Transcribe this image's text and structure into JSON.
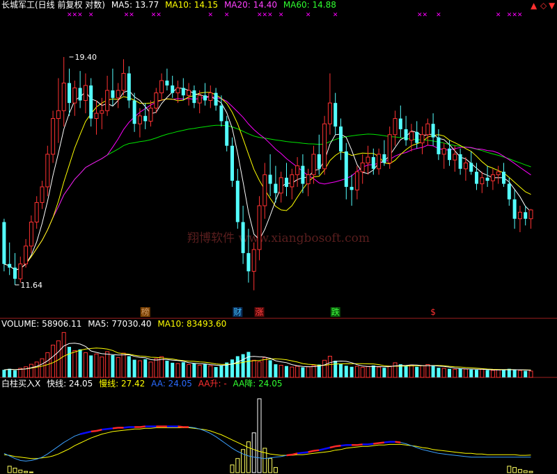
{
  "header": {
    "title": "长城军工(日线 前复权 对数)",
    "ma5": "MA5: 13.77",
    "ma10": "MA10: 14.15",
    "ma20": "MA20: 14.40",
    "ma60": "MA60: 14.88",
    "corner_up": "▲",
    "corner_diamond": "◇",
    "corner_down": "▼"
  },
  "volume_header": {
    "label": "VOLUME: 58906.11",
    "ma5": "MA5: 77030.40",
    "ma10": "MA10: 83493.60"
  },
  "indicator_header": {
    "label": "白柱买入X",
    "fast": "快线: 24.05",
    "slow": "慢线: 27.42",
    "aa": "AA: 24.05",
    "aa_up": "AA升: -",
    "aa_down": "AA降: 24.05"
  },
  "watermark": "翔博软件  www.xiangbosoft.com",
  "colors": {
    "up": "#ff3232",
    "down": "#54ffff",
    "ma5": "#ffffff",
    "ma10": "#ffff00",
    "ma20": "#ff00ff",
    "ma60": "#00e600",
    "fast": "#3ca0ff",
    "slow": "#ffff00",
    "aa": "#0a0aff",
    "aa_up": "#ff2828",
    "mark": "#ff00ff",
    "watermark": "#5a1e1e"
  },
  "chart_data": {
    "type": "candlestick",
    "price": {
      "scale": "log",
      "ylim": [
        10.8,
        21.5
      ]
    },
    "annotations": [
      {
        "text": "19.40",
        "index": 12,
        "value": 19.4
      },
      {
        "text": "11.64",
        "index": 2,
        "value": 11.64
      }
    ],
    "event_labels": [
      {
        "text": "榜",
        "index": 26,
        "color": "#cc9966",
        "bg": "#7a4000"
      },
      {
        "text": "财",
        "index": 43,
        "color": "#40c0ff",
        "bg": "#0a2e5a"
      },
      {
        "text": "涨",
        "index": 47,
        "color": "#ff4040",
        "bg": "#5a0a0a"
      },
      {
        "text": "跌",
        "index": 61,
        "color": "#40ff40",
        "bg": "#0a5a0a"
      },
      {
        "text": "$",
        "index": 79,
        "color": "#ff3030",
        "bg": ""
      }
    ],
    "marks": [
      {
        "text": "✕✕✕",
        "index": 13
      },
      {
        "text": "✕",
        "index": 16
      },
      {
        "text": "✕✕",
        "index": 23
      },
      {
        "text": "✕✕",
        "index": 28
      },
      {
        "text": "✕",
        "index": 38
      },
      {
        "text": "✕",
        "index": 41
      },
      {
        "text": "✕✕✕",
        "index": 48
      },
      {
        "text": "✕",
        "index": 51
      },
      {
        "text": "✕",
        "index": 56
      },
      {
        "text": "✕",
        "index": 61
      },
      {
        "text": "✕✕",
        "index": 77
      },
      {
        "text": "✕",
        "index": 80
      },
      {
        "text": "✕",
        "index": 91
      },
      {
        "text": "✕✕✕",
        "index": 94
      }
    ],
    "ohlc": [
      [
        13.4,
        13.5,
        12.0,
        12.2
      ],
      [
        12.2,
        12.8,
        11.9,
        12.1
      ],
      [
        12.1,
        12.5,
        11.64,
        11.8
      ],
      [
        11.8,
        12.4,
        11.7,
        12.2
      ],
      [
        12.2,
        12.9,
        12.1,
        12.7
      ],
      [
        12.7,
        13.6,
        12.5,
        13.4
      ],
      [
        13.4,
        14.2,
        13.2,
        14.0
      ],
      [
        14.0,
        14.7,
        13.8,
        14.5
      ],
      [
        14.5,
        15.9,
        14.2,
        15.6
      ],
      [
        15.6,
        17.2,
        15.3,
        16.9
      ],
      [
        16.9,
        18.5,
        16.0,
        17.2
      ],
      [
        17.2,
        19.4,
        16.6,
        18.3
      ],
      [
        18.3,
        18.9,
        17.0,
        17.5
      ],
      [
        17.5,
        18.4,
        17.0,
        18.1
      ],
      [
        18.1,
        18.8,
        17.3,
        17.6
      ],
      [
        17.6,
        18.7,
        17.1,
        18.2
      ],
      [
        18.2,
        18.5,
        16.6,
        16.9
      ],
      [
        16.9,
        17.6,
        16.3,
        17.1
      ],
      [
        17.1,
        17.7,
        16.5,
        17.2
      ],
      [
        17.2,
        18.6,
        17.0,
        18.0
      ],
      [
        18.0,
        18.9,
        17.4,
        17.7
      ],
      [
        17.7,
        18.3,
        17.3,
        18.0
      ],
      [
        18.0,
        19.3,
        17.8,
        18.7
      ],
      [
        18.7,
        19.0,
        17.3,
        17.6
      ],
      [
        17.6,
        17.9,
        16.4,
        16.7
      ],
      [
        16.7,
        17.3,
        16.2,
        17.0
      ],
      [
        17.0,
        17.5,
        16.5,
        16.8
      ],
      [
        16.8,
        17.6,
        16.6,
        17.3
      ],
      [
        17.3,
        18.1,
        17.1,
        17.9
      ],
      [
        17.9,
        18.7,
        17.6,
        18.4
      ],
      [
        18.4,
        18.9,
        18.0,
        18.2
      ],
      [
        18.2,
        18.6,
        17.7,
        17.9
      ],
      [
        17.9,
        18.4,
        17.5,
        18.1
      ],
      [
        18.1,
        18.5,
        17.6,
        17.8
      ],
      [
        17.8,
        18.3,
        17.4,
        18.0
      ],
      [
        18.0,
        18.2,
        17.3,
        17.5
      ],
      [
        17.5,
        18.0,
        17.1,
        17.8
      ],
      [
        17.8,
        18.3,
        17.4,
        17.6
      ],
      [
        17.6,
        18.2,
        17.3,
        17.9
      ],
      [
        17.9,
        18.1,
        17.2,
        17.4
      ],
      [
        17.4,
        17.8,
        16.6,
        16.8
      ],
      [
        16.8,
        17.0,
        15.7,
        15.9
      ],
      [
        15.9,
        16.2,
        14.5,
        14.7
      ],
      [
        14.7,
        15.1,
        13.2,
        13.4
      ],
      [
        13.4,
        13.9,
        12.2,
        12.5
      ],
      [
        12.5,
        13.2,
        11.7,
        12.0
      ],
      [
        12.0,
        12.8,
        11.5,
        12.6
      ],
      [
        12.6,
        14.2,
        12.3,
        13.9
      ],
      [
        13.9,
        15.3,
        13.5,
        14.9
      ],
      [
        14.9,
        15.6,
        14.2,
        14.6
      ],
      [
        14.6,
        15.2,
        14.0,
        14.3
      ],
      [
        14.3,
        15.0,
        14.0,
        14.8
      ],
      [
        14.8,
        15.3,
        14.2,
        14.5
      ],
      [
        14.5,
        15.1,
        14.1,
        14.9
      ],
      [
        14.9,
        15.5,
        14.5,
        15.2
      ],
      [
        15.2,
        15.6,
        14.3,
        14.6
      ],
      [
        14.6,
        15.1,
        14.2,
        14.9
      ],
      [
        14.9,
        15.9,
        14.6,
        15.6
      ],
      [
        15.6,
        16.3,
        14.9,
        15.1
      ],
      [
        15.1,
        17.0,
        14.9,
        16.7
      ],
      [
        16.7,
        18.7,
        16.3,
        17.5
      ],
      [
        17.5,
        17.9,
        16.3,
        16.6
      ],
      [
        16.6,
        16.9,
        15.4,
        15.7
      ],
      [
        15.7,
        16.0,
        14.1,
        14.5
      ],
      [
        14.5,
        14.9,
        13.9,
        14.4
      ],
      [
        14.4,
        15.2,
        14.1,
        15.0
      ],
      [
        15.0,
        15.6,
        14.6,
        15.3
      ],
      [
        15.3,
        15.9,
        14.9,
        15.5
      ],
      [
        15.5,
        15.8,
        14.9,
        15.1
      ],
      [
        15.1,
        15.8,
        14.9,
        15.6
      ],
      [
        15.6,
        16.1,
        15.2,
        15.3
      ],
      [
        15.3,
        16.6,
        15.1,
        16.3
      ],
      [
        16.3,
        17.2,
        15.9,
        16.9
      ],
      [
        16.9,
        17.4,
        16.2,
        16.5
      ],
      [
        16.5,
        17.0,
        15.9,
        16.1
      ],
      [
        16.1,
        16.7,
        15.7,
        16.4
      ],
      [
        16.4,
        16.8,
        15.8,
        16.0
      ],
      [
        16.0,
        16.6,
        15.6,
        16.3
      ],
      [
        16.3,
        16.9,
        15.9,
        16.7
      ],
      [
        16.7,
        17.1,
        15.9,
        16.2
      ],
      [
        16.2,
        16.5,
        15.4,
        15.6
      ],
      [
        15.6,
        16.0,
        15.1,
        15.8
      ],
      [
        15.8,
        16.1,
        15.2,
        15.4
      ],
      [
        15.4,
        15.9,
        15.0,
        15.6
      ],
      [
        15.6,
        15.8,
        14.9,
        15.1
      ],
      [
        15.1,
        15.5,
        14.7,
        15.3
      ],
      [
        15.3,
        15.7,
        14.9,
        15.0
      ],
      [
        15.0,
        15.3,
        14.4,
        14.6
      ],
      [
        14.6,
        15.0,
        14.3,
        14.8
      ],
      [
        14.8,
        15.2,
        14.5,
        14.7
      ],
      [
        14.7,
        15.1,
        14.4,
        14.9
      ],
      [
        14.9,
        15.2,
        14.6,
        15.0
      ],
      [
        15.0,
        15.3,
        14.5,
        14.6
      ],
      [
        14.6,
        14.8,
        13.9,
        14.1
      ],
      [
        14.1,
        14.4,
        13.2,
        13.5
      ],
      [
        13.5,
        13.9,
        13.1,
        13.7
      ],
      [
        13.7,
        13.9,
        13.3,
        13.5
      ],
      [
        13.5,
        13.8,
        13.2,
        13.77
      ]
    ],
    "volume": {
      "ylim": [
        0,
        190000
      ],
      "values": [
        30000,
        34000,
        28000,
        36000,
        42000,
        52000,
        61000,
        74000,
        98000,
        128000,
        145000,
        178000,
        121000,
        106000,
        111000,
        98000,
        87000,
        93000,
        81000,
        102000,
        88000,
        79000,
        96000,
        84000,
        70000,
        66000,
        72000,
        61000,
        74000,
        82000,
        66000,
        58000,
        55000,
        60000,
        51000,
        56000,
        48000,
        52000,
        46000,
        41000,
        48000,
        59000,
        71000,
        84000,
        92000,
        101000,
        68000,
        62000,
        79000,
        68000,
        52000,
        48000,
        45000,
        41000,
        44000,
        40000,
        42000,
        47000,
        51000,
        68000,
        84000,
        66000,
        54000,
        46000,
        42000,
        44000,
        40000,
        43000,
        47000,
        41000,
        38000,
        45000,
        58000,
        52000,
        44000,
        49000,
        42000,
        47000,
        51000,
        45000,
        38000,
        36000,
        34000,
        32000,
        35000,
        33000,
        31000,
        30000,
        32000,
        29000,
        28000,
        30000,
        31000,
        34000,
        29000,
        27000,
        26000,
        25000
      ]
    },
    "indicator": {
      "ylim": [
        0,
        130
      ],
      "fast": [
        30,
        26,
        22,
        19,
        18,
        19,
        21,
        24,
        29,
        35,
        41,
        47,
        52,
        57,
        60,
        62,
        64,
        65,
        67,
        68,
        69,
        70,
        70,
        71,
        71,
        71,
        72,
        72,
        72,
        72,
        72,
        72,
        72,
        71,
        71,
        70,
        68,
        65,
        61,
        56,
        50,
        44,
        38,
        33,
        29,
        26,
        24,
        23,
        22,
        23,
        24,
        25,
        27,
        28,
        30,
        31,
        32,
        34,
        35,
        37,
        39,
        41,
        42,
        43,
        43,
        43,
        44,
        44,
        45,
        46,
        47,
        48,
        48,
        47,
        45,
        42,
        39,
        36,
        34,
        32,
        30,
        29,
        28,
        27,
        26,
        25,
        24,
        24,
        24,
        24,
        24,
        24,
        24,
        24,
        24,
        24,
        24,
        24.05
      ],
      "slow": [
        28,
        27,
        25,
        24,
        23,
        22,
        22,
        23,
        24,
        26,
        29,
        33,
        37,
        42,
        46,
        50,
        54,
        57,
        60,
        62,
        64,
        65,
        66,
        67,
        68,
        68,
        69,
        69,
        70,
        70,
        70,
        70,
        70,
        70,
        70,
        69,
        68,
        67,
        65,
        62,
        59,
        55,
        51,
        47,
        43,
        39,
        36,
        33,
        31,
        29,
        28,
        27,
        27,
        27,
        28,
        28,
        29,
        30,
        31,
        32,
        33,
        35,
        36,
        38,
        39,
        40,
        41,
        41,
        42,
        43,
        43,
        44,
        44,
        44,
        43,
        42,
        41,
        39,
        38,
        36,
        35,
        34,
        33,
        32,
        31,
        30,
        30,
        29,
        29,
        28,
        28,
        28,
        28,
        28,
        28,
        27,
        27,
        27.42
      ],
      "bars": [
        {
          "index": 1,
          "value": 10
        },
        {
          "index": 2,
          "value": 7
        },
        {
          "index": 3,
          "value": 4
        },
        {
          "index": 4,
          "value": 2
        },
        {
          "index": 5,
          "value": 1
        },
        {
          "index": 42,
          "value": 12
        },
        {
          "index": 43,
          "value": 22
        },
        {
          "index": 44,
          "value": 36
        },
        {
          "index": 45,
          "value": 48
        },
        {
          "index": 46,
          "value": 62
        },
        {
          "index": 47,
          "value": 115
        },
        {
          "index": 48,
          "value": 38
        },
        {
          "index": 49,
          "value": 22
        },
        {
          "index": 50,
          "value": 8
        },
        {
          "index": 93,
          "value": 10
        },
        {
          "index": 94,
          "value": 8
        },
        {
          "index": 95,
          "value": 5
        },
        {
          "index": 96,
          "value": 3
        },
        {
          "index": 97,
          "value": 2
        }
      ],
      "aa_up_ranges": [
        [
          14,
          34
        ],
        [
          52,
          73
        ]
      ]
    }
  }
}
